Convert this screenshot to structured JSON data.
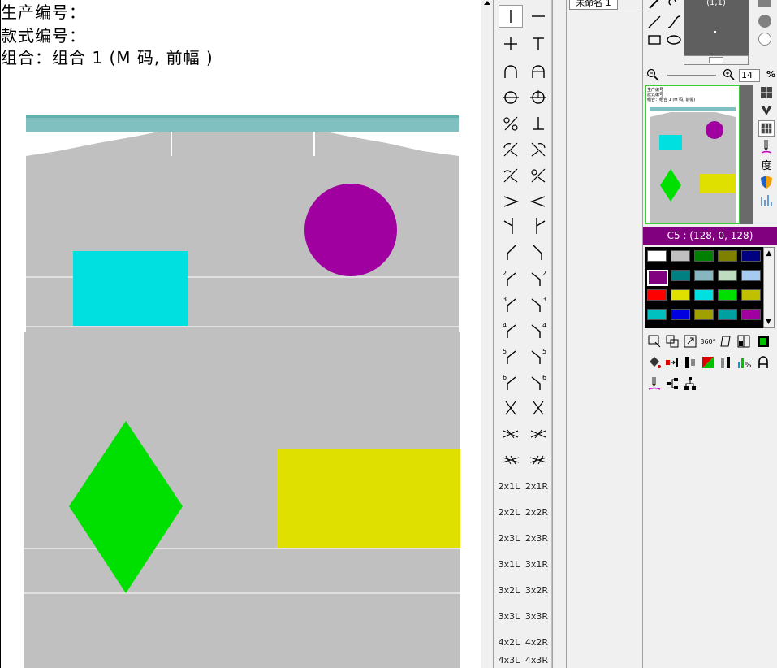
{
  "canvas": {
    "info_lines": [
      "生产编号：",
      "款式编号：",
      "组合：组合 1 (M 码, 前幅 )"
    ]
  },
  "tools": {
    "text_tools": [
      "2x1L",
      "2x1R",
      "2x2L",
      "2x2R",
      "2x3L",
      "2x3R",
      "3x1L",
      "3x1R",
      "3x2L",
      "3x2R",
      "3x3L",
      "3x3R",
      "4x2L",
      "4x2R",
      "4x3L",
      "4x3R"
    ],
    "numbered": [
      "2",
      "2",
      "3",
      "3",
      "4",
      "4",
      "5",
      "5",
      "6",
      "6"
    ]
  },
  "document": {
    "tab_label": "未命名 1"
  },
  "preview": {
    "coordinate": "(1,1)"
  },
  "zoom": {
    "value": "14",
    "unit": "%"
  },
  "thumbnail": {
    "lines": [
      "生产编号",
      "款式编号",
      "组合：组合 1 (M 码, 前幅)"
    ]
  },
  "side_icons": {
    "degree_label": "度"
  },
  "color": {
    "current_label": "C5 : (128, 0, 128)",
    "swatches": [
      "#ffffff",
      "#c0c0c0",
      "#008000",
      "#808000",
      "#000080",
      "#800080",
      "#008080",
      "#87b5c0",
      "#c0dcc0",
      "#a6caf0",
      "#ff0000",
      "#e0e000",
      "#00e0e0",
      "#00e000",
      "#c0c000",
      "#00c0c0",
      "#0000e0",
      "#a0a000",
      "#00a0a0",
      "#a000a0"
    ]
  },
  "bottom_tools": {
    "angle_label": "360°",
    "percent_label": "%"
  }
}
